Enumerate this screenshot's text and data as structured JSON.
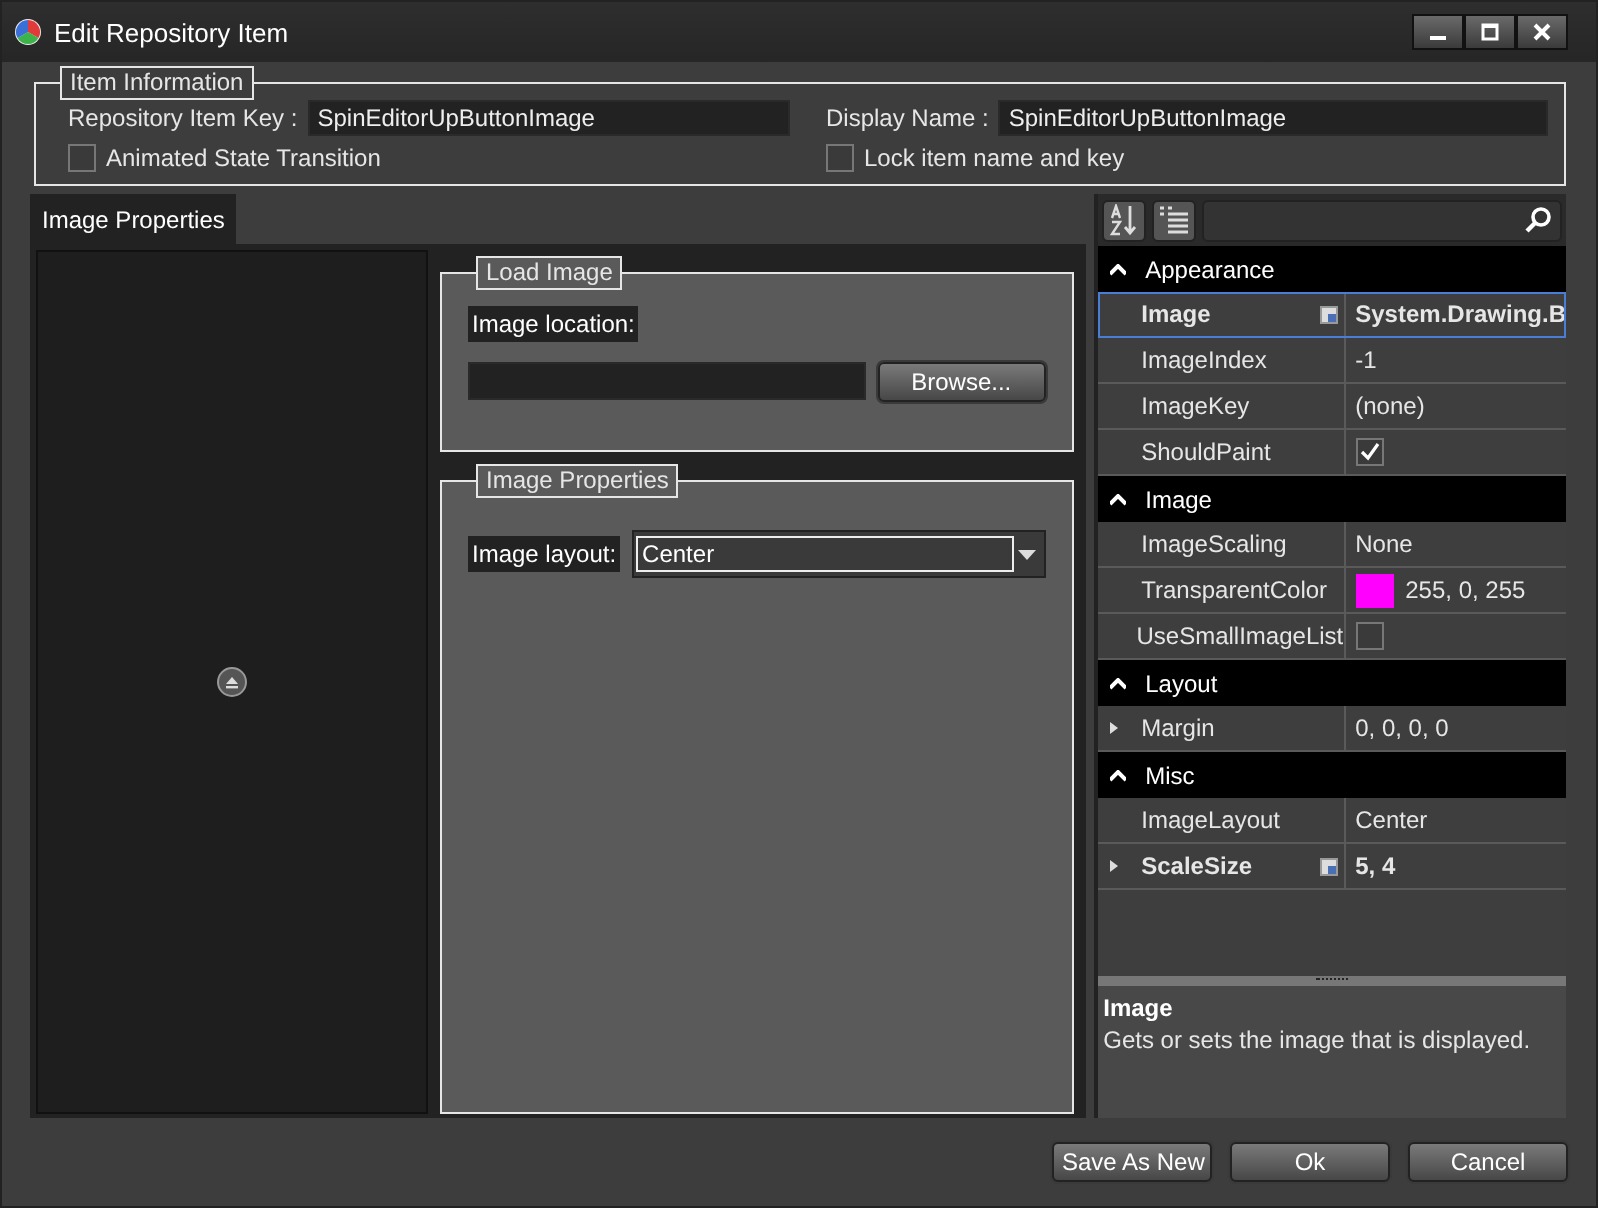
{
  "window": {
    "title": "Edit Repository Item"
  },
  "item_information": {
    "title": "Item Information",
    "fields": [
      {
        "label": "Repository Item Key :",
        "value": "SpinEditorUpButtonImage"
      },
      {
        "label": "Display Name :",
        "value": "SpinEditorUpButtonImage"
      }
    ],
    "checkboxes": [
      {
        "label": "Animated State Transition",
        "checked": false
      },
      {
        "label": "Lock item name and key",
        "checked": false
      }
    ]
  },
  "tabs": [
    {
      "label": "Image Properties",
      "selected": true
    }
  ],
  "load_image": {
    "title": "Load Image",
    "location_label": "Image location:",
    "browse_button": "Browse..."
  },
  "image_properties": {
    "title": "Image Properties",
    "layout_label": "Image layout:",
    "layout_value": "Center"
  },
  "property_grid": {
    "categories": [
      {
        "name": "Appearance",
        "expanded": true,
        "properties": [
          {
            "name": "Image",
            "value": "System.Drawing.B",
            "kind": "text",
            "bold": true,
            "selected": true,
            "expandable": false,
            "editor_icon": true
          },
          {
            "name": "ImageIndex",
            "value": "-1",
            "kind": "text",
            "bold": false,
            "selected": false,
            "expandable": false,
            "editor_icon": false
          },
          {
            "name": "ImageKey",
            "value": "(none)",
            "kind": "text",
            "bold": false,
            "selected": false,
            "expandable": false,
            "editor_icon": false
          },
          {
            "name": "ShouldPaint",
            "kind": "checkbox",
            "checked": true,
            "bold": false,
            "selected": false,
            "expandable": false,
            "editor_icon": false
          }
        ]
      },
      {
        "name": "Image",
        "expanded": true,
        "properties": [
          {
            "name": "ImageScaling",
            "value": "None",
            "kind": "text",
            "bold": false,
            "selected": false,
            "expandable": false,
            "editor_icon": false
          },
          {
            "name": "TransparentColor",
            "value": "255, 0, 255",
            "kind": "color",
            "color": "#ff00ff",
            "bold": false,
            "selected": false,
            "expandable": false,
            "editor_icon": false
          },
          {
            "name": "UseSmallImageList",
            "kind": "checkbox",
            "checked": false,
            "bold": false,
            "selected": false,
            "expandable": false,
            "editor_icon": false
          }
        ]
      },
      {
        "name": "Layout",
        "expanded": true,
        "properties": [
          {
            "name": "Margin",
            "value": "0, 0, 0, 0",
            "kind": "text",
            "bold": false,
            "selected": false,
            "expandable": true,
            "editor_icon": false
          }
        ]
      },
      {
        "name": "Misc",
        "expanded": true,
        "properties": [
          {
            "name": "ImageLayout",
            "value": "Center",
            "kind": "text",
            "bold": false,
            "selected": false,
            "expandable": false,
            "editor_icon": false
          },
          {
            "name": "ScaleSize",
            "value": "5, 4",
            "kind": "text",
            "bold": true,
            "selected": false,
            "expandable": true,
            "editor_icon": true
          }
        ]
      }
    ],
    "description": {
      "title": "Image",
      "text": "Gets or sets the image that is displayed."
    }
  },
  "buttons": [
    "Save As New",
    "Ok",
    "Cancel"
  ]
}
